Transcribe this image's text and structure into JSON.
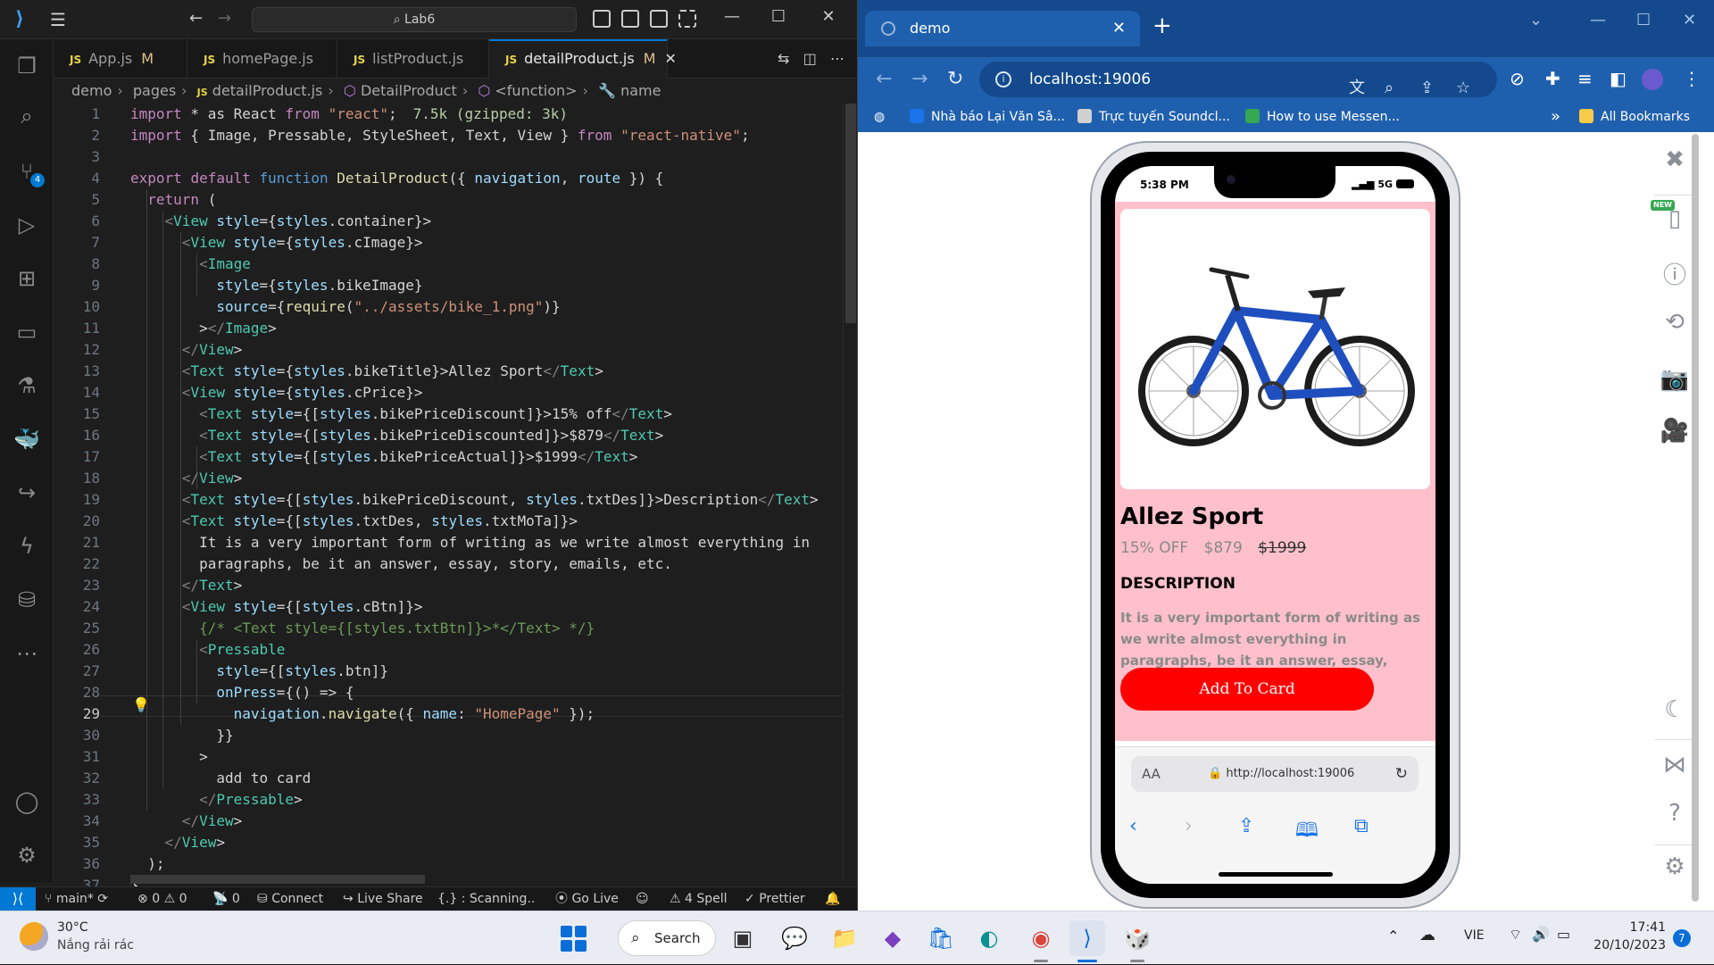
{
  "vscode": {
    "search_text": "Lab6",
    "tabs": [
      {
        "label": "App.js",
        "modified": "M"
      },
      {
        "label": "homePage.js",
        "modified": ""
      },
      {
        "label": "listProduct.js",
        "modified": ""
      },
      {
        "label": "detailProduct.js",
        "modified": "M"
      }
    ],
    "tab_icon_text": "JS",
    "breadcrumb": [
      "demo",
      "pages",
      "detailProduct.js",
      "DetailProduct",
      "<function>",
      "name"
    ],
    "line_numbers": [
      "1",
      "2",
      "3",
      "4",
      "5",
      "6",
      "7",
      "8",
      "9",
      "10",
      "11",
      "12",
      "13",
      "14",
      "15",
      "16",
      "17",
      "18",
      "19",
      "20",
      "21",
      "22",
      "23",
      "24",
      "25",
      "26",
      "27",
      "28",
      "29",
      "30",
      "31",
      "32",
      "33",
      "34",
      "35",
      "36",
      "37"
    ],
    "codelens_size": "7.5k (gzipped: 3k)",
    "code_lines": [
      "import * as React from \"react\";",
      "import { Image, Pressable, StyleSheet, Text, View } from \"react-native\";",
      "",
      "export default function DetailProduct({ navigation, route }) {",
      "  return (",
      "    <View style={styles.container}>",
      "      <View style={styles.cImage}>",
      "        <Image",
      "          style={styles.bikeImage}",
      "          source={require(\"../assets/bike_1.png\")}",
      "        ></Image>",
      "      </View>",
      "      <Text style={styles.bikeTitle}>Allez Sport</Text>",
      "      <View style={styles.cPrice}>",
      "        <Text style={[styles.bikePriceDiscount]}>15% off</Text>",
      "        <Text style={[styles.bikePriceDiscounted]}>$879</Text>",
      "        <Text style={[styles.bikePriceActual]}>$1999</Text>",
      "      </View>",
      "      <Text style={[styles.bikePriceDiscount, styles.txtDes]}>Description</Text>",
      "      <Text style={[styles.txtDes, styles.txtMoTa]}>",
      "        It is a very important form of writing as we write almost everything in",
      "        paragraphs, be it an answer, essay, story, emails, etc.",
      "      </Text>",
      "      <View style={[styles.cBtn]}>",
      "        {/* <Text style={[styles.txtBtn]}>*</Text> */}",
      "        <Pressable",
      "          style={[styles.btn]}",
      "          onPress={() => {",
      "            navigation.navigate({ name: \"HomePage\" });",
      "          }}",
      "        >",
      "          add to card",
      "        </Pressable>",
      "      </View>",
      "    </View>",
      "  );",
      "}"
    ],
    "status": {
      "branch": "main*",
      "errors": "0",
      "warnings": "0",
      "ports": "0",
      "connect": "Connect",
      "live_share": "Live Share",
      "scanning": "{.} : Scanning..",
      "go_live": "Go Live",
      "spell": "4 Spell",
      "prettier": "Prettier"
    },
    "scm_badge": "4"
  },
  "chrome": {
    "tab_title": "demo",
    "url": "localhost:19006",
    "bookmarks": [
      {
        "label": "Nhà báo Lại Văn Sâ...",
        "color": "#1a73e8"
      },
      {
        "label": "Trực tuyến Soundcl...",
        "color": "#d0d0d0"
      },
      {
        "label": "How to use Messen...",
        "color": "#34a853"
      }
    ],
    "more_bookmarks": "»",
    "all_bookmarks": "All Bookmarks",
    "new_badge": "NEW"
  },
  "phone": {
    "time": "5:38 PM",
    "network": "5G",
    "product_title": "Allez Sport",
    "discount": "15% OFF",
    "price_discounted": "$879",
    "price_actual": "$1999",
    "description_title": "DESCRIPTION",
    "description": "It is a very important form of writing as we write almost everything in paragraphs, be it an answer, essay, story, emails, etc.",
    "button_label": "Add To Card",
    "safari_aa": "AA",
    "safari_url": "http://localhost:19006",
    "app_bg": "#ffc0cb",
    "button_color": "#ff0000"
  },
  "taskbar": {
    "temperature": "30°C",
    "condition": "Nắng rải rác",
    "search_label": "Search",
    "language": "VIE",
    "time": "17:41",
    "date": "20/10/2023",
    "notifications": "7"
  }
}
